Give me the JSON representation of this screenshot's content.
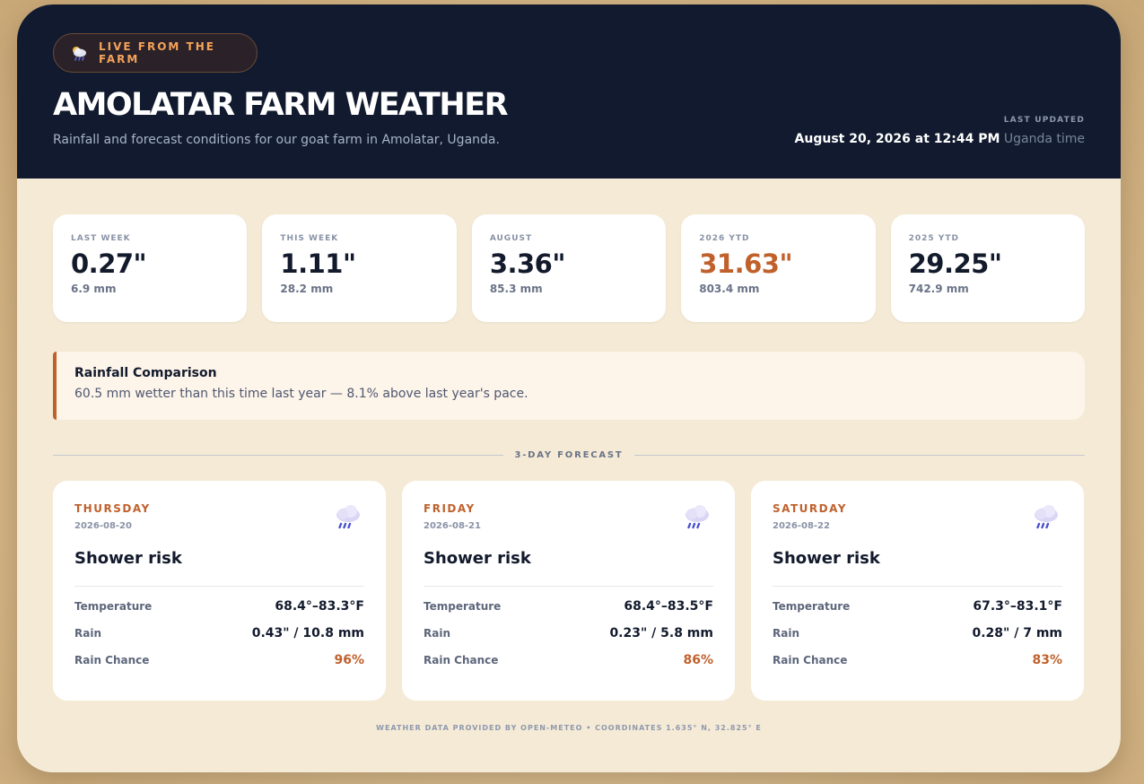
{
  "header": {
    "badge": {
      "label": "LIVE FROM THE FARM",
      "icon": "cloud-sun-rain-icon"
    },
    "title": "AMOLATAR FARM WEATHER",
    "subtitle": "Rainfall and forecast conditions for our goat farm in Amolatar, Uganda.",
    "last_updated_label": "LAST UPDATED",
    "last_updated_date": "August 20, 2026 at 12:44 PM",
    "last_updated_tz": "Uganda time"
  },
  "stats": [
    {
      "label": "LAST WEEK",
      "value": "0.27\"",
      "mm": "6.9 mm"
    },
    {
      "label": "THIS WEEK",
      "value": "1.11\"",
      "mm": "28.2 mm"
    },
    {
      "label": "AUGUST",
      "value": "3.36\"",
      "mm": "85.3 mm"
    },
    {
      "label": "2026 YTD",
      "value": "31.63\"",
      "mm": "803.4 mm"
    },
    {
      "label": "2025 YTD",
      "value": "29.25\"",
      "mm": "742.9 mm"
    }
  ],
  "comparison": {
    "title": "Rainfall Comparison",
    "text": "60.5 mm wetter than this time last year — 8.1% above last year's pace."
  },
  "forecast_heading": "3-DAY FORECAST",
  "row_labels": {
    "temperature": "Temperature",
    "rain": "Rain",
    "rain_chance": "Rain Chance"
  },
  "forecast": [
    {
      "day": "THURSDAY",
      "date": "2026-08-20",
      "condition": "Shower risk",
      "icon": "rain-cloud-icon",
      "temperature": "68.4°–83.3°F",
      "rain": "0.43\" / 10.8 mm",
      "rain_chance": "96%"
    },
    {
      "day": "FRIDAY",
      "date": "2026-08-21",
      "condition": "Shower risk",
      "icon": "rain-cloud-icon",
      "temperature": "68.4°–83.5°F",
      "rain": "0.23\" / 5.8 mm",
      "rain_chance": "86%"
    },
    {
      "day": "SATURDAY",
      "date": "2026-08-22",
      "condition": "Shower risk",
      "icon": "rain-cloud-icon",
      "temperature": "67.3°–83.1°F",
      "rain": "0.28\" / 7 mm",
      "rain_chance": "83%"
    }
  ],
  "footer": "WEATHER DATA PROVIDED BY OPEN-METEO • COORDINATES 1.635° N, 32.825° E",
  "colors": {
    "header_bg": "#111a2e",
    "page_bg": "#f5ead6",
    "accent": "#c0612c",
    "badge_text": "#f5a35a"
  }
}
